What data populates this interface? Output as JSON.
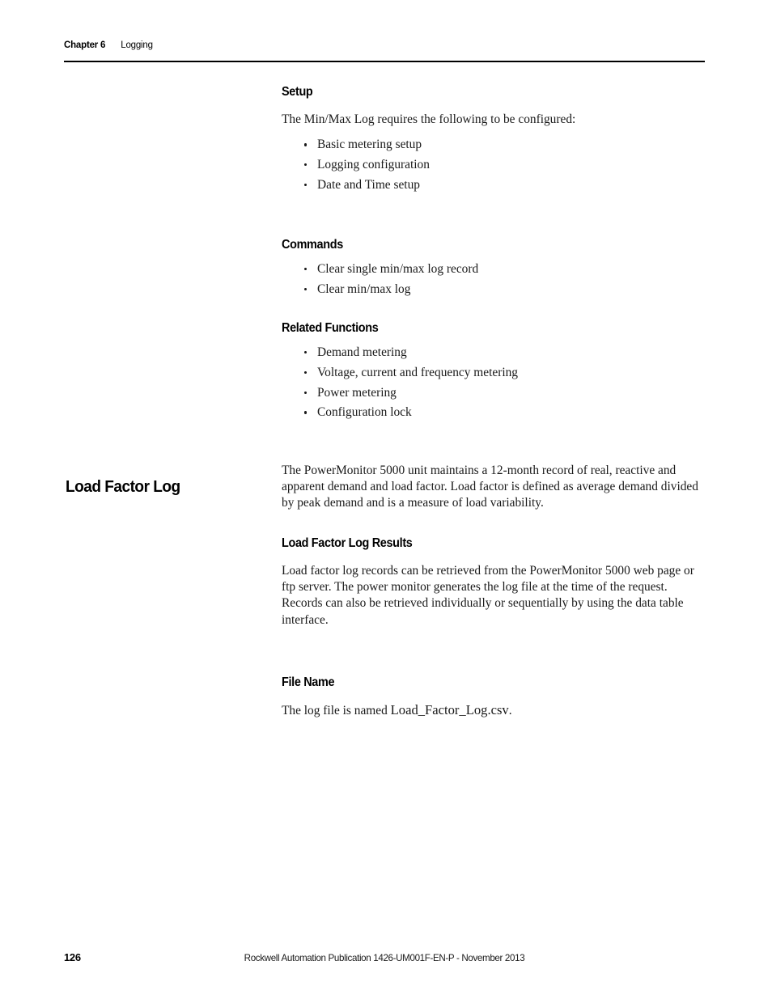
{
  "header": {
    "chapter_label": "Chapter 6",
    "chapter_topic": "Logging"
  },
  "sections": {
    "setup": {
      "heading": "Setup",
      "intro": "The Min/Max Log requires the following to be configured:",
      "bullets": [
        "Basic metering setup",
        "Logging configuration",
        "Date and Time setup"
      ]
    },
    "commands": {
      "heading": "Commands",
      "bullets": [
        "Clear single min/max log record",
        "Clear min/max log"
      ]
    },
    "related_functions": {
      "heading": "Related Functions",
      "bullets": [
        "Demand metering",
        "Voltage, current and frequency metering",
        "Power metering",
        "Configuration lock"
      ]
    },
    "load_factor_log": {
      "margin_heading": "Load Factor Log",
      "body": "The PowerMonitor 5000 unit maintains a 12-month record of real, reactive and apparent demand and load factor. Load factor is defined as average demand divided by peak demand and is a measure of load variability."
    },
    "load_factor_log_results": {
      "heading": "Load Factor Log Results",
      "body": "Load factor log records can be retrieved from the PowerMonitor 5000 web page or ftp server. The power monitor generates the log file at the time of the request. Records can also be retrieved individually or sequentially by using the data table interface."
    },
    "file_name": {
      "heading": "File Name",
      "body_prefix": "The log file is named ",
      "file_name": "Load_Factor_Log.csv",
      "body_suffix": "."
    }
  },
  "footer": {
    "page_number": "126",
    "publication": "Rockwell Automation Publication 1426-UM001F-EN-P - November 2013"
  }
}
